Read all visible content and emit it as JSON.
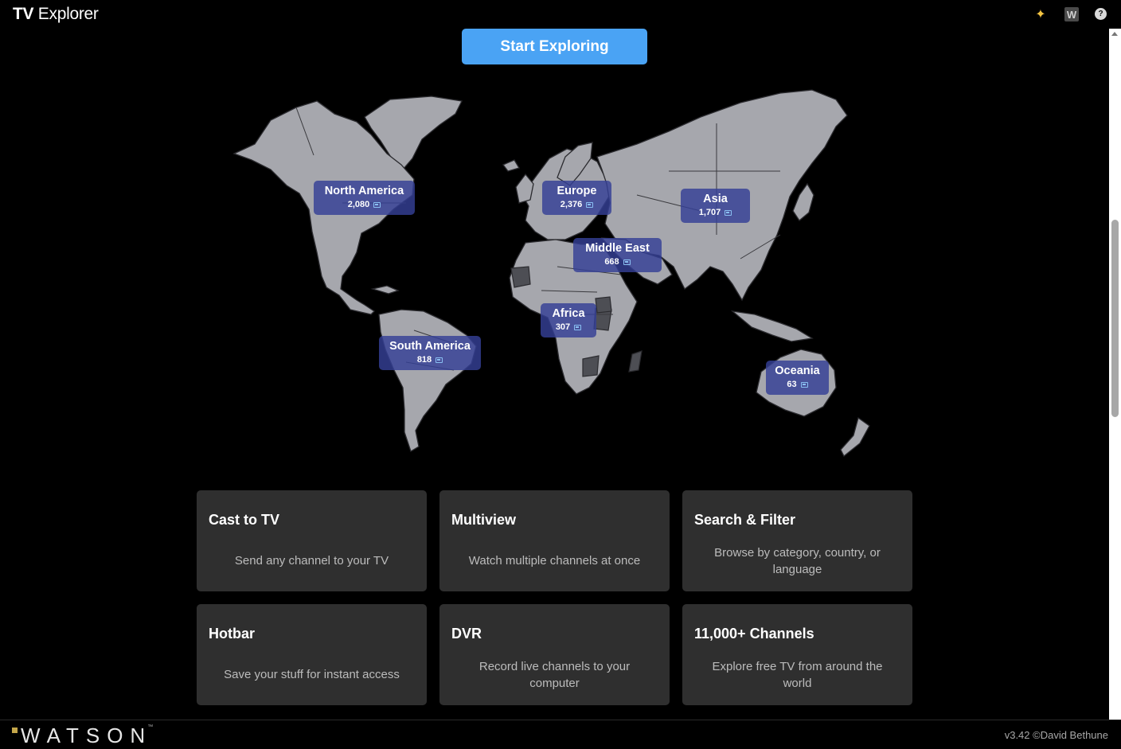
{
  "app": {
    "title_bold": "TV",
    "title_rest": "Explorer"
  },
  "titlebar_icons": [
    "sparkle-icon",
    "w-icon",
    "help-icon"
  ],
  "titlebar_icon_glyphs": {
    "sparkle": "✦",
    "w": "W",
    "help": "?"
  },
  "hero": {
    "start_label": "Start Exploring"
  },
  "regions": {
    "north_america": {
      "name": "North America",
      "count": "2,080"
    },
    "europe": {
      "name": "Europe",
      "count": "2,376"
    },
    "asia": {
      "name": "Asia",
      "count": "1,707"
    },
    "middle_east": {
      "name": "Middle East",
      "count": "668"
    },
    "africa": {
      "name": "Africa",
      "count": "307"
    },
    "south_america": {
      "name": "South America",
      "count": "818"
    },
    "oceania": {
      "name": "Oceania",
      "count": "63"
    }
  },
  "features": {
    "cast": {
      "title": "Cast to TV",
      "desc": "Send any channel to your TV"
    },
    "multiview": {
      "title": "Multiview",
      "desc": "Watch multiple channels at once"
    },
    "search": {
      "title": "Search & Filter",
      "desc": "Browse by category, country, or language"
    },
    "hotbar": {
      "title": "Hotbar",
      "desc": "Save your stuff for instant access"
    },
    "dvr": {
      "title": "DVR",
      "desc": "Record live channels to your computer"
    },
    "channels": {
      "title": "11,000+ Channels",
      "desc": "Explore free TV from around the world"
    }
  },
  "footer": {
    "brand": "WATSON",
    "trademark": "™",
    "version": "v3.42 ©David Bethune"
  },
  "colors": {
    "accent": "#4aa3f4",
    "region_label": "#344096",
    "card_bg": "#2f2f2f",
    "land": "#a6a7ad",
    "brand_square": "#c4a64a"
  }
}
